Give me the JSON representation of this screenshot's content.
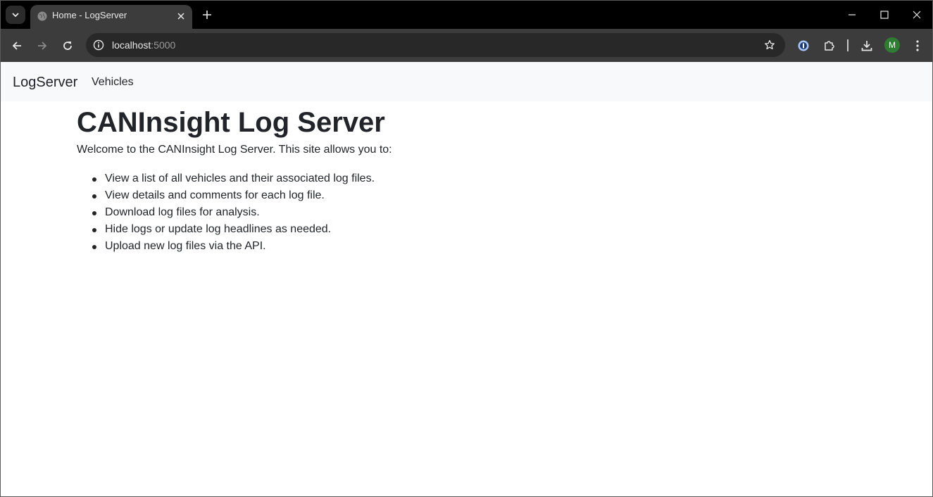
{
  "browser": {
    "tab": {
      "title": "Home - LogServer"
    },
    "address_bar": {
      "host": "localhost",
      "port": ":5000"
    },
    "profile_initial": "M"
  },
  "site": {
    "brand": "LogServer",
    "nav": [
      {
        "label": "Vehicles"
      }
    ]
  },
  "main": {
    "heading": "CANInsight Log Server",
    "intro": "Welcome to the CANInsight Log Server. This site allows you to:",
    "features": [
      "View a list of all vehicles and their associated log files.",
      "View details and comments for each log file.",
      "Download log files for analysis.",
      "Hide logs or update log headlines as needed.",
      "Upload new log files via the API."
    ]
  },
  "colors": {
    "navbar_bg": "#f8f9fa",
    "text": "#212529",
    "tabstrip_bg": "#000000",
    "toolbar_bg": "#3c3c3c",
    "avatar_bg": "#2e7d32"
  }
}
